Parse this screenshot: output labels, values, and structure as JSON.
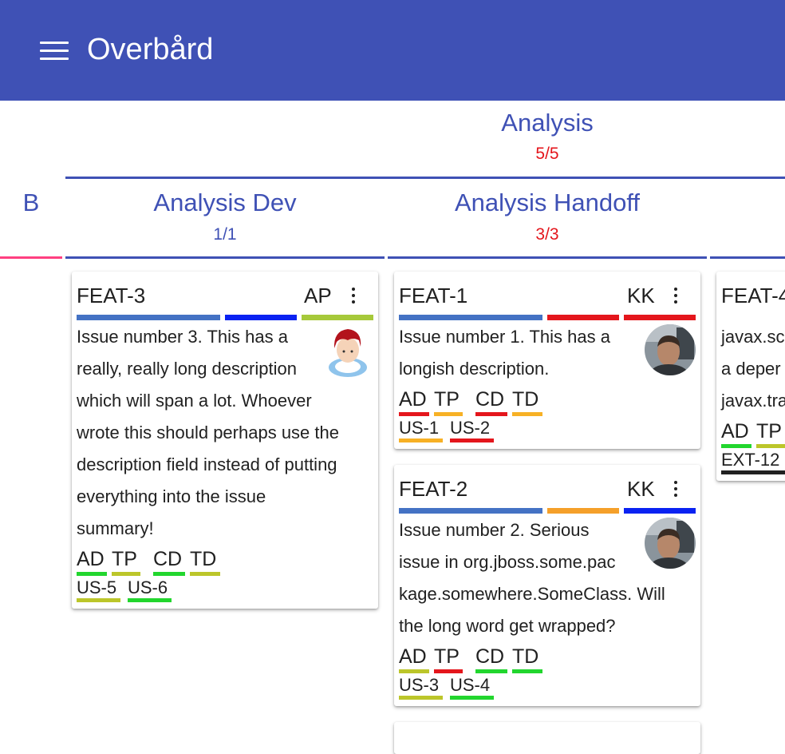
{
  "app": {
    "title": "Overbård"
  },
  "colors": {
    "primary": "#3f51b5",
    "red": "#e4161c",
    "pink": "#ff4081"
  },
  "headers": {
    "partial_left": "B",
    "analysis": {
      "name": "Analysis",
      "count": "5/5"
    },
    "analysis_dev": {
      "name": "Analysis Dev",
      "count": "1/1"
    },
    "analysis_handoff": {
      "name": "Analysis Handoff",
      "count": "3/3"
    }
  },
  "cards": {
    "feat3": {
      "key": "FEAT-3",
      "assignee": "AP",
      "avatar_icon": "cartoon-person-icon",
      "summary": [
        "Issue number 3. This has a",
        "really, really long description",
        "which will span a lot. Whoever",
        "wrote this should perhaps use the",
        "description field instead of putting",
        "everything into the issue",
        "summary!"
      ],
      "bar_colors": [
        "#4472c4",
        "#0a22f2",
        "#a6c93a"
      ],
      "states": [
        {
          "label": "AD",
          "color": "#22d62e"
        },
        {
          "label": "TP",
          "color": "#bcc62a"
        },
        {
          "label": "CD",
          "color": "#22d62e"
        },
        {
          "label": "TD",
          "color": "#bcc62a"
        }
      ],
      "links": [
        {
          "label": "US-5",
          "color": "#bcc62a"
        },
        {
          "label": "US-6",
          "color": "#22d62e"
        }
      ]
    },
    "feat1": {
      "key": "FEAT-1",
      "assignee": "KK",
      "avatar_icon": "person-photo-icon",
      "summary": [
        "Issue number 1. This has a",
        "longish description."
      ],
      "bar_colors": [
        "#4472c4",
        "#e4161c",
        "#e4161c"
      ],
      "states": [
        {
          "label": "AD",
          "color": "#e4161c"
        },
        {
          "label": "TP",
          "color": "#f7b125"
        },
        {
          "label": "CD",
          "color": "#e4161c"
        },
        {
          "label": "TD",
          "color": "#f7b125"
        }
      ],
      "links": [
        {
          "label": "US-1",
          "color": "#f7b125"
        },
        {
          "label": "US-2",
          "color": "#e4161c"
        }
      ]
    },
    "feat2": {
      "key": "FEAT-2",
      "assignee": "KK",
      "avatar_icon": "person-photo-icon",
      "summary": [
        "Issue number 2. Serious",
        "issue in org.jboss.some.pac",
        "kage.somewhere.SomeClass. Will",
        "the long word get wrapped?"
      ],
      "bar_colors": [
        "#4472c4",
        "#f5a02a",
        "#0a22f2"
      ],
      "states": [
        {
          "label": "AD",
          "color": "#bcc62a"
        },
        {
          "label": "TP",
          "color": "#e4161c"
        },
        {
          "label": "CD",
          "color": "#22d62e"
        },
        {
          "label": "TD",
          "color": "#22d62e"
        }
      ],
      "links": [
        {
          "label": "US-3",
          "color": "#bcc62a"
        },
        {
          "label": "US-4",
          "color": "#22d62e"
        }
      ]
    },
    "feat4": {
      "key": "FEAT-4",
      "summary": [
        "javax.sc",
        "a deper",
        "javax.tra"
      ],
      "states": [
        {
          "label": "AD",
          "color": "#22d62e"
        },
        {
          "label": "TP",
          "color": "#bcc62a"
        }
      ],
      "links": [
        {
          "label": "EXT-12",
          "color": "#212121"
        }
      ]
    }
  }
}
